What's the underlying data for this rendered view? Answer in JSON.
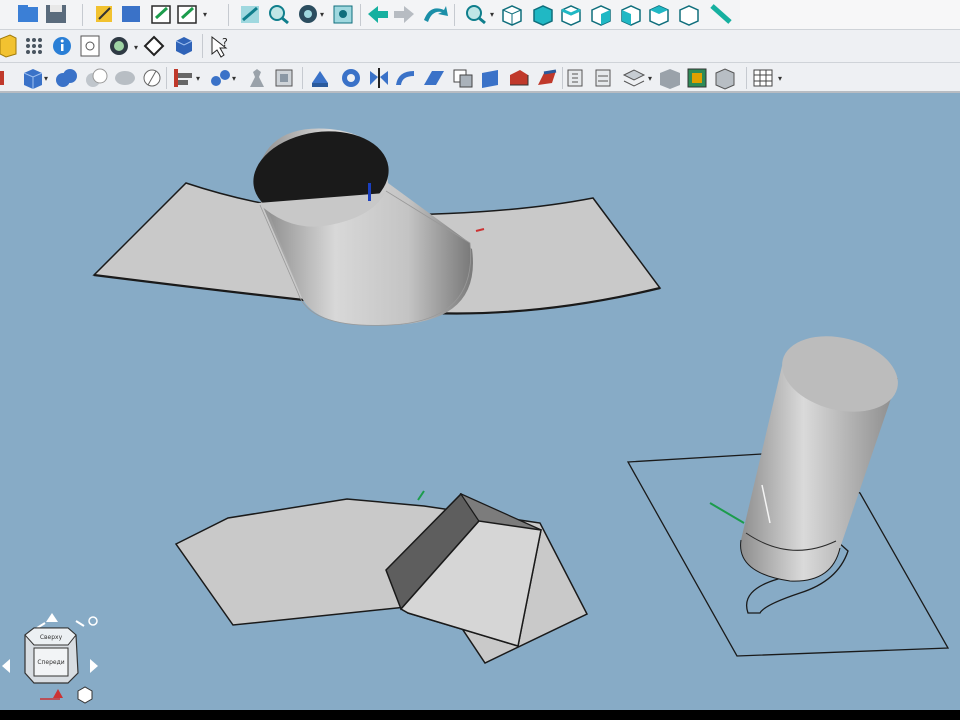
{
  "app": {
    "name": "3D CAD modeling application",
    "viewport_background": "#87abc6"
  },
  "toolbars": {
    "row1_icons": [
      "open-file",
      "save-file",
      "sketch",
      "box",
      "edit-sketch",
      "edit-feature",
      "view-fit",
      "zoom",
      "view-style",
      "view-box",
      "undo",
      "redo",
      "rotate",
      "zoom-area",
      "view-iso",
      "view-front",
      "view-top",
      "view-right",
      "view-left",
      "view-back",
      "measure"
    ],
    "row2_icons": [
      "part-folder",
      "grid",
      "info",
      "checklist",
      "material",
      "diamond",
      "cube-small",
      "select-cursor"
    ],
    "row3_icons": [
      "solid-box",
      "boolean-union",
      "boolean-subtract",
      "boolean-intersect",
      "boolean-split",
      "align",
      "pattern",
      "chess",
      "sheet",
      "extrude",
      "revolve",
      "mirror",
      "sweep",
      "loft",
      "offset",
      "thicken",
      "fillet",
      "chamfer",
      "surface-a",
      "surface-b",
      "stack",
      "levels",
      "shell",
      "color",
      "cube-view",
      "grid-view"
    ]
  },
  "navigation": {
    "cube_face_front": "Спереди",
    "cube_face_top": "Сверху"
  },
  "scene": {
    "model_color": "#c8c8c8",
    "edge_color": "#1a1a1a"
  }
}
